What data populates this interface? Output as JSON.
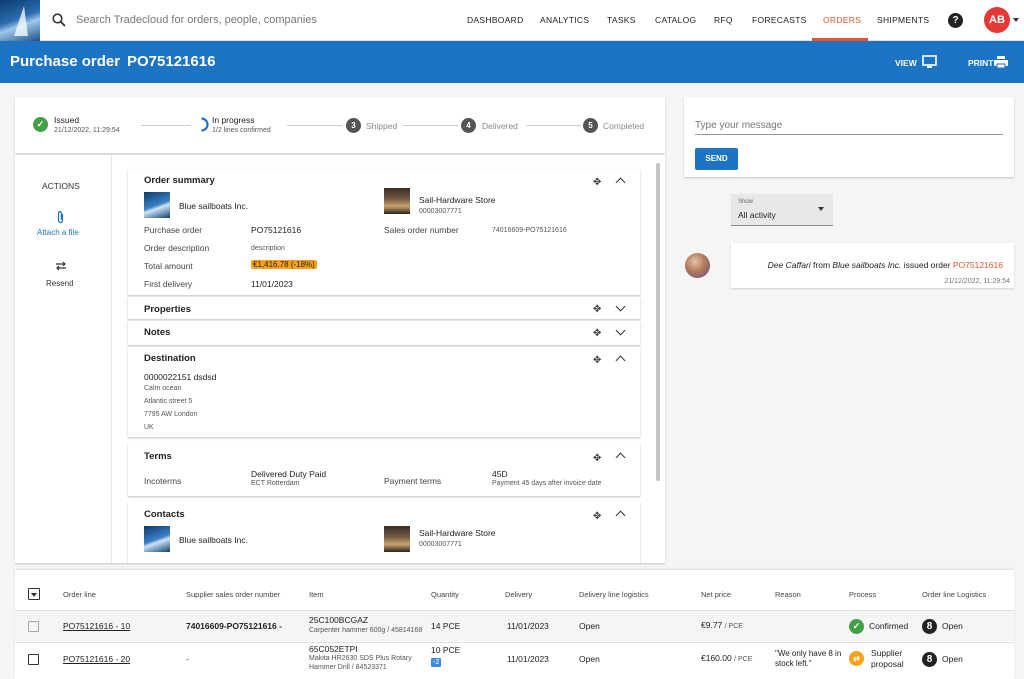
{
  "nav": {
    "search_placeholder": "Search Tradecloud for orders, people, companies",
    "items": [
      "DASHBOARD",
      "ANALYTICS",
      "TASKS",
      "CATALOG",
      "RFQ",
      "FORECASTS",
      "ORDERS",
      "SHIPMENTS"
    ],
    "active": "ORDERS",
    "help_label": "?",
    "avatar_initials": "AB",
    "accent_color": "#e8552a"
  },
  "header": {
    "title": "Purchase order",
    "order_number": "PO75121616",
    "view_label": "VIEW",
    "print_label": "PRINT",
    "color": "#1e74c4"
  },
  "progress": {
    "steps": [
      {
        "label": "Issued",
        "sub": "21/12/2022, 11:29:54",
        "state": "done"
      },
      {
        "label": "In progress",
        "sub": "1/2  lines confirmed",
        "state": "current"
      },
      {
        "num": "3",
        "label": "Shipped",
        "state": "todo"
      },
      {
        "num": "4",
        "label": "Delivered",
        "state": "todo"
      },
      {
        "num": "5",
        "label": "Completed",
        "state": "todo"
      }
    ]
  },
  "actions": {
    "title": "ACTIONS",
    "attach_label": "Attach a file",
    "resend_label": "Resend"
  },
  "order_summary": {
    "title": "Order summary",
    "buyer_name": "Blue sailboats Inc.",
    "supplier_name": "Sail-Hardware Store",
    "supplier_id": "00003007771",
    "purchase_order_label": "Purchase order",
    "purchase_order_value": "PO75121616",
    "description_label": "Order description",
    "description_value": "description",
    "total_label": "Total amount",
    "total_value": "€1,416.78 (-18%)",
    "first_delivery_label": "First delivery",
    "first_delivery_value": "11/01/2023",
    "sales_order_label": "Sales order number",
    "sales_order_value": "74016609-PO75121616"
  },
  "properties": {
    "title": "Properties"
  },
  "notes": {
    "title": "Notes"
  },
  "destination": {
    "title": "Destination",
    "code": "0000022151 dsdsd",
    "lines": [
      "Calm ocean",
      "Atlantic street 5",
      "7795 AW London",
      "UK"
    ]
  },
  "terms": {
    "title": "Terms",
    "incoterms_label": "Incoterms",
    "incoterms_value": "Delivered Duty Paid",
    "incoterms_place": "ECT Rotterdam",
    "payment_label": "Payment terms",
    "payment_value": "45D",
    "payment_desc": "Payment 45 days after invoice date"
  },
  "contacts": {
    "title": "Contacts",
    "buyer_name": "Blue sailboats Inc.",
    "supplier_name": "Sail-Hardware Store",
    "supplier_id": "00003007771"
  },
  "chat": {
    "placeholder": "Type your message",
    "send_label": "SEND",
    "show_label": "Show",
    "show_value": "All activity",
    "activity_person": "Dee Caffari",
    "activity_from": " from ",
    "activity_company": "Blue sailboats Inc.",
    "activity_text": " issued order ",
    "activity_order": "PO75121616",
    "activity_time": "21/12/2022, 11:29:54"
  },
  "lines_table": {
    "headers": [
      "Order line",
      "Supplier sales order number",
      "Item",
      "Quantity",
      "Delivery",
      "Delivery line logistics",
      "Net price",
      "Reason",
      "Process",
      "Order line Logistics"
    ],
    "rows": [
      {
        "order_line": "PO75121616 - 10",
        "supplier_so": "74016609-PO75121616 -",
        "item_code": "25C100BCGAZ",
        "item_desc": "Carpenter hammer 600g / 45814168",
        "quantity": "14 PCE",
        "delivery": "11/01/2023",
        "delivery_logistics": "Open",
        "net_price": "€9.77",
        "price_unit": "/ PCE",
        "reason": "",
        "process": "Confirmed",
        "logistics": "Open"
      },
      {
        "order_line": "PO75121616 - 20",
        "supplier_so": "-",
        "item_code": "65C052ETPI",
        "item_desc": "Makita HR2630 SDS Plus Rotary",
        "item_desc2": "Hammer Drill / 84523371",
        "quantity": "10 PCE",
        "quantity_badge": "-2",
        "delivery": "11/01/2023",
        "delivery_logistics": "Open",
        "net_price": "€160.00",
        "price_unit": "/ PCE",
        "reason": "\"We only have 8 in",
        "reason2": "stock left.\"",
        "process": "Supplier",
        "process2": "proposal",
        "logistics": "Open"
      }
    ]
  }
}
